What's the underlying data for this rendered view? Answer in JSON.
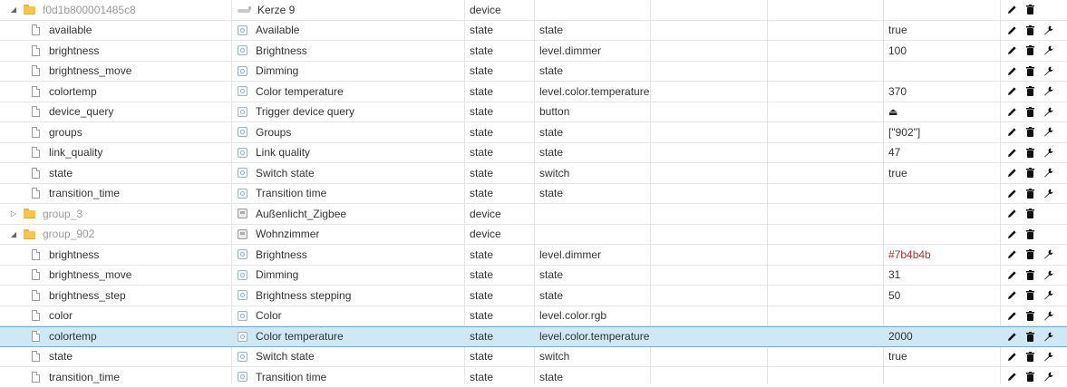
{
  "colors": {
    "accent_selected_bg": "#cfe8f6",
    "accent_selected_border": "#5fb3de",
    "value_red": "#b03030"
  },
  "rows": [
    {
      "type": "folder",
      "expanded": true,
      "id": "f0d1b800001485c8",
      "name": "Kerze 9",
      "name_icon": "candle-icon",
      "role": "device",
      "type_col": "",
      "value": "",
      "actions": [
        "edit",
        "delete"
      ]
    },
    {
      "type": "state",
      "id": "available",
      "name": "Available",
      "role": "state",
      "type_col": "state",
      "value": "true",
      "actions": [
        "edit",
        "delete",
        "wrench"
      ]
    },
    {
      "type": "state",
      "id": "brightness",
      "name": "Brightness",
      "role": "state",
      "type_col": "level.dimmer",
      "value": "100",
      "actions": [
        "edit",
        "delete",
        "wrench"
      ]
    },
    {
      "type": "state",
      "id": "brightness_move",
      "name": "Dimming",
      "role": "state",
      "type_col": "state",
      "value": "",
      "actions": [
        "edit",
        "delete",
        "wrench"
      ]
    },
    {
      "type": "state",
      "id": "colortemp",
      "name": "Color temperature",
      "role": "state",
      "type_col": "level.color.temperature",
      "value": "370",
      "actions": [
        "edit",
        "delete",
        "wrench"
      ]
    },
    {
      "type": "state",
      "id": "device_query",
      "name": "Trigger device query",
      "role": "state",
      "type_col": "button",
      "value": "",
      "value_icon": "eject-icon",
      "actions": [
        "edit",
        "delete",
        "wrench"
      ]
    },
    {
      "type": "state",
      "id": "groups",
      "name": "Groups",
      "role": "state",
      "type_col": "state",
      "value": "[\"902\"]",
      "actions": [
        "edit",
        "delete",
        "wrench"
      ]
    },
    {
      "type": "state",
      "id": "link_quality",
      "name": "Link quality",
      "role": "state",
      "type_col": "state",
      "value": "47",
      "actions": [
        "edit",
        "delete",
        "wrench"
      ]
    },
    {
      "type": "state",
      "id": "state",
      "name": "Switch state",
      "role": "state",
      "type_col": "switch",
      "value": "true",
      "actions": [
        "edit",
        "delete",
        "wrench"
      ]
    },
    {
      "type": "state",
      "id": "transition_time",
      "name": "Transition time",
      "role": "state",
      "type_col": "state",
      "value": "",
      "actions": [
        "edit",
        "delete",
        "wrench"
      ]
    },
    {
      "type": "folder",
      "expanded": false,
      "id": "group_3",
      "name": "Außenlicht_Zigbee",
      "name_icon": "device-icon",
      "role": "device",
      "type_col": "",
      "value": "",
      "actions": [
        "edit",
        "delete"
      ]
    },
    {
      "type": "folder",
      "expanded": true,
      "id": "group_902",
      "name": "Wohnzimmer",
      "name_icon": "device-icon",
      "role": "device",
      "type_col": "",
      "value": "",
      "actions": [
        "edit",
        "delete"
      ]
    },
    {
      "type": "state",
      "id": "brightness",
      "name": "Brightness",
      "role": "state",
      "type_col": "level.dimmer",
      "value": "#7b4b4b",
      "value_color": "#b03030",
      "actions": [
        "edit",
        "delete",
        "wrench"
      ]
    },
    {
      "type": "state",
      "id": "brightness_move",
      "name": "Dimming",
      "role": "state",
      "type_col": "state",
      "value": "31",
      "actions": [
        "edit",
        "delete",
        "wrench"
      ]
    },
    {
      "type": "state",
      "id": "brightness_step",
      "name": "Brightness stepping",
      "role": "state",
      "type_col": "state",
      "value": "50",
      "actions": [
        "edit",
        "delete",
        "wrench"
      ]
    },
    {
      "type": "state",
      "id": "color",
      "name": "Color",
      "role": "state",
      "type_col": "level.color.rgb",
      "value": "",
      "actions": [
        "edit",
        "delete",
        "wrench"
      ]
    },
    {
      "type": "state",
      "id": "colortemp",
      "name": "Color temperature",
      "role": "state",
      "type_col": "level.color.temperature",
      "value": "2000",
      "selected": true,
      "actions": [
        "edit",
        "delete",
        "wrench"
      ]
    },
    {
      "type": "state",
      "id": "state",
      "name": "Switch state",
      "role": "state",
      "type_col": "switch",
      "value": "true",
      "actions": [
        "edit",
        "delete",
        "wrench"
      ]
    },
    {
      "type": "state",
      "id": "transition_time",
      "name": "Transition time",
      "role": "state",
      "type_col": "state",
      "value": "",
      "actions": [
        "edit",
        "delete",
        "wrench"
      ]
    }
  ]
}
